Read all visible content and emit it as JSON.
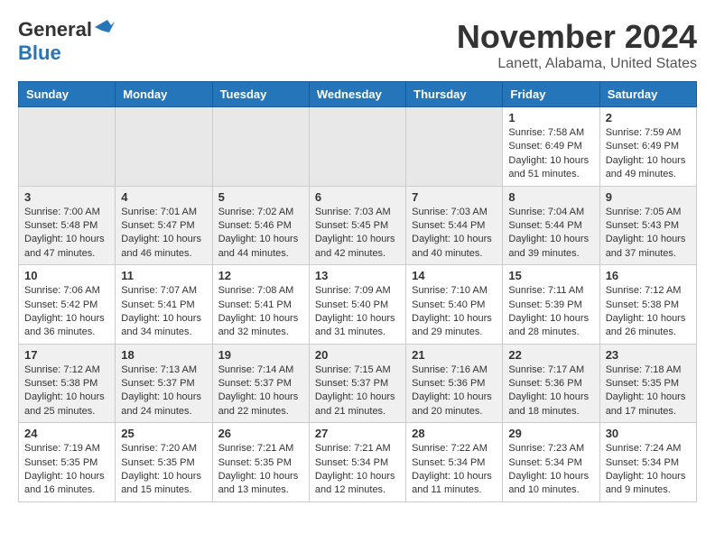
{
  "header": {
    "logo_line1": "General",
    "logo_line2": "Blue",
    "month_title": "November 2024",
    "location": "Lanett, Alabama, United States"
  },
  "weekdays": [
    "Sunday",
    "Monday",
    "Tuesday",
    "Wednesday",
    "Thursday",
    "Friday",
    "Saturday"
  ],
  "weeks": [
    {
      "days": [
        {
          "number": "",
          "info": ""
        },
        {
          "number": "",
          "info": ""
        },
        {
          "number": "",
          "info": ""
        },
        {
          "number": "",
          "info": ""
        },
        {
          "number": "",
          "info": ""
        },
        {
          "number": "1",
          "info": "Sunrise: 7:58 AM\nSunset: 6:49 PM\nDaylight: 10 hours\nand 51 minutes."
        },
        {
          "number": "2",
          "info": "Sunrise: 7:59 AM\nSunset: 6:49 PM\nDaylight: 10 hours\nand 49 minutes."
        }
      ]
    },
    {
      "days": [
        {
          "number": "3",
          "info": "Sunrise: 7:00 AM\nSunset: 5:48 PM\nDaylight: 10 hours\nand 47 minutes."
        },
        {
          "number": "4",
          "info": "Sunrise: 7:01 AM\nSunset: 5:47 PM\nDaylight: 10 hours\nand 46 minutes."
        },
        {
          "number": "5",
          "info": "Sunrise: 7:02 AM\nSunset: 5:46 PM\nDaylight: 10 hours\nand 44 minutes."
        },
        {
          "number": "6",
          "info": "Sunrise: 7:03 AM\nSunset: 5:45 PM\nDaylight: 10 hours\nand 42 minutes."
        },
        {
          "number": "7",
          "info": "Sunrise: 7:03 AM\nSunset: 5:44 PM\nDaylight: 10 hours\nand 40 minutes."
        },
        {
          "number": "8",
          "info": "Sunrise: 7:04 AM\nSunset: 5:44 PM\nDaylight: 10 hours\nand 39 minutes."
        },
        {
          "number": "9",
          "info": "Sunrise: 7:05 AM\nSunset: 5:43 PM\nDaylight: 10 hours\nand 37 minutes."
        }
      ]
    },
    {
      "days": [
        {
          "number": "10",
          "info": "Sunrise: 7:06 AM\nSunset: 5:42 PM\nDaylight: 10 hours\nand 36 minutes."
        },
        {
          "number": "11",
          "info": "Sunrise: 7:07 AM\nSunset: 5:41 PM\nDaylight: 10 hours\nand 34 minutes."
        },
        {
          "number": "12",
          "info": "Sunrise: 7:08 AM\nSunset: 5:41 PM\nDaylight: 10 hours\nand 32 minutes."
        },
        {
          "number": "13",
          "info": "Sunrise: 7:09 AM\nSunset: 5:40 PM\nDaylight: 10 hours\nand 31 minutes."
        },
        {
          "number": "14",
          "info": "Sunrise: 7:10 AM\nSunset: 5:40 PM\nDaylight: 10 hours\nand 29 minutes."
        },
        {
          "number": "15",
          "info": "Sunrise: 7:11 AM\nSunset: 5:39 PM\nDaylight: 10 hours\nand 28 minutes."
        },
        {
          "number": "16",
          "info": "Sunrise: 7:12 AM\nSunset: 5:38 PM\nDaylight: 10 hours\nand 26 minutes."
        }
      ]
    },
    {
      "days": [
        {
          "number": "17",
          "info": "Sunrise: 7:12 AM\nSunset: 5:38 PM\nDaylight: 10 hours\nand 25 minutes."
        },
        {
          "number": "18",
          "info": "Sunrise: 7:13 AM\nSunset: 5:37 PM\nDaylight: 10 hours\nand 24 minutes."
        },
        {
          "number": "19",
          "info": "Sunrise: 7:14 AM\nSunset: 5:37 PM\nDaylight: 10 hours\nand 22 minutes."
        },
        {
          "number": "20",
          "info": "Sunrise: 7:15 AM\nSunset: 5:37 PM\nDaylight: 10 hours\nand 21 minutes."
        },
        {
          "number": "21",
          "info": "Sunrise: 7:16 AM\nSunset: 5:36 PM\nDaylight: 10 hours\nand 20 minutes."
        },
        {
          "number": "22",
          "info": "Sunrise: 7:17 AM\nSunset: 5:36 PM\nDaylight: 10 hours\nand 18 minutes."
        },
        {
          "number": "23",
          "info": "Sunrise: 7:18 AM\nSunset: 5:35 PM\nDaylight: 10 hours\nand 17 minutes."
        }
      ]
    },
    {
      "days": [
        {
          "number": "24",
          "info": "Sunrise: 7:19 AM\nSunset: 5:35 PM\nDaylight: 10 hours\nand 16 minutes."
        },
        {
          "number": "25",
          "info": "Sunrise: 7:20 AM\nSunset: 5:35 PM\nDaylight: 10 hours\nand 15 minutes."
        },
        {
          "number": "26",
          "info": "Sunrise: 7:21 AM\nSunset: 5:35 PM\nDaylight: 10 hours\nand 13 minutes."
        },
        {
          "number": "27",
          "info": "Sunrise: 7:21 AM\nSunset: 5:34 PM\nDaylight: 10 hours\nand 12 minutes."
        },
        {
          "number": "28",
          "info": "Sunrise: 7:22 AM\nSunset: 5:34 PM\nDaylight: 10 hours\nand 11 minutes."
        },
        {
          "number": "29",
          "info": "Sunrise: 7:23 AM\nSunset: 5:34 PM\nDaylight: 10 hours\nand 10 minutes."
        },
        {
          "number": "30",
          "info": "Sunrise: 7:24 AM\nSunset: 5:34 PM\nDaylight: 10 hours\nand 9 minutes."
        }
      ]
    }
  ]
}
